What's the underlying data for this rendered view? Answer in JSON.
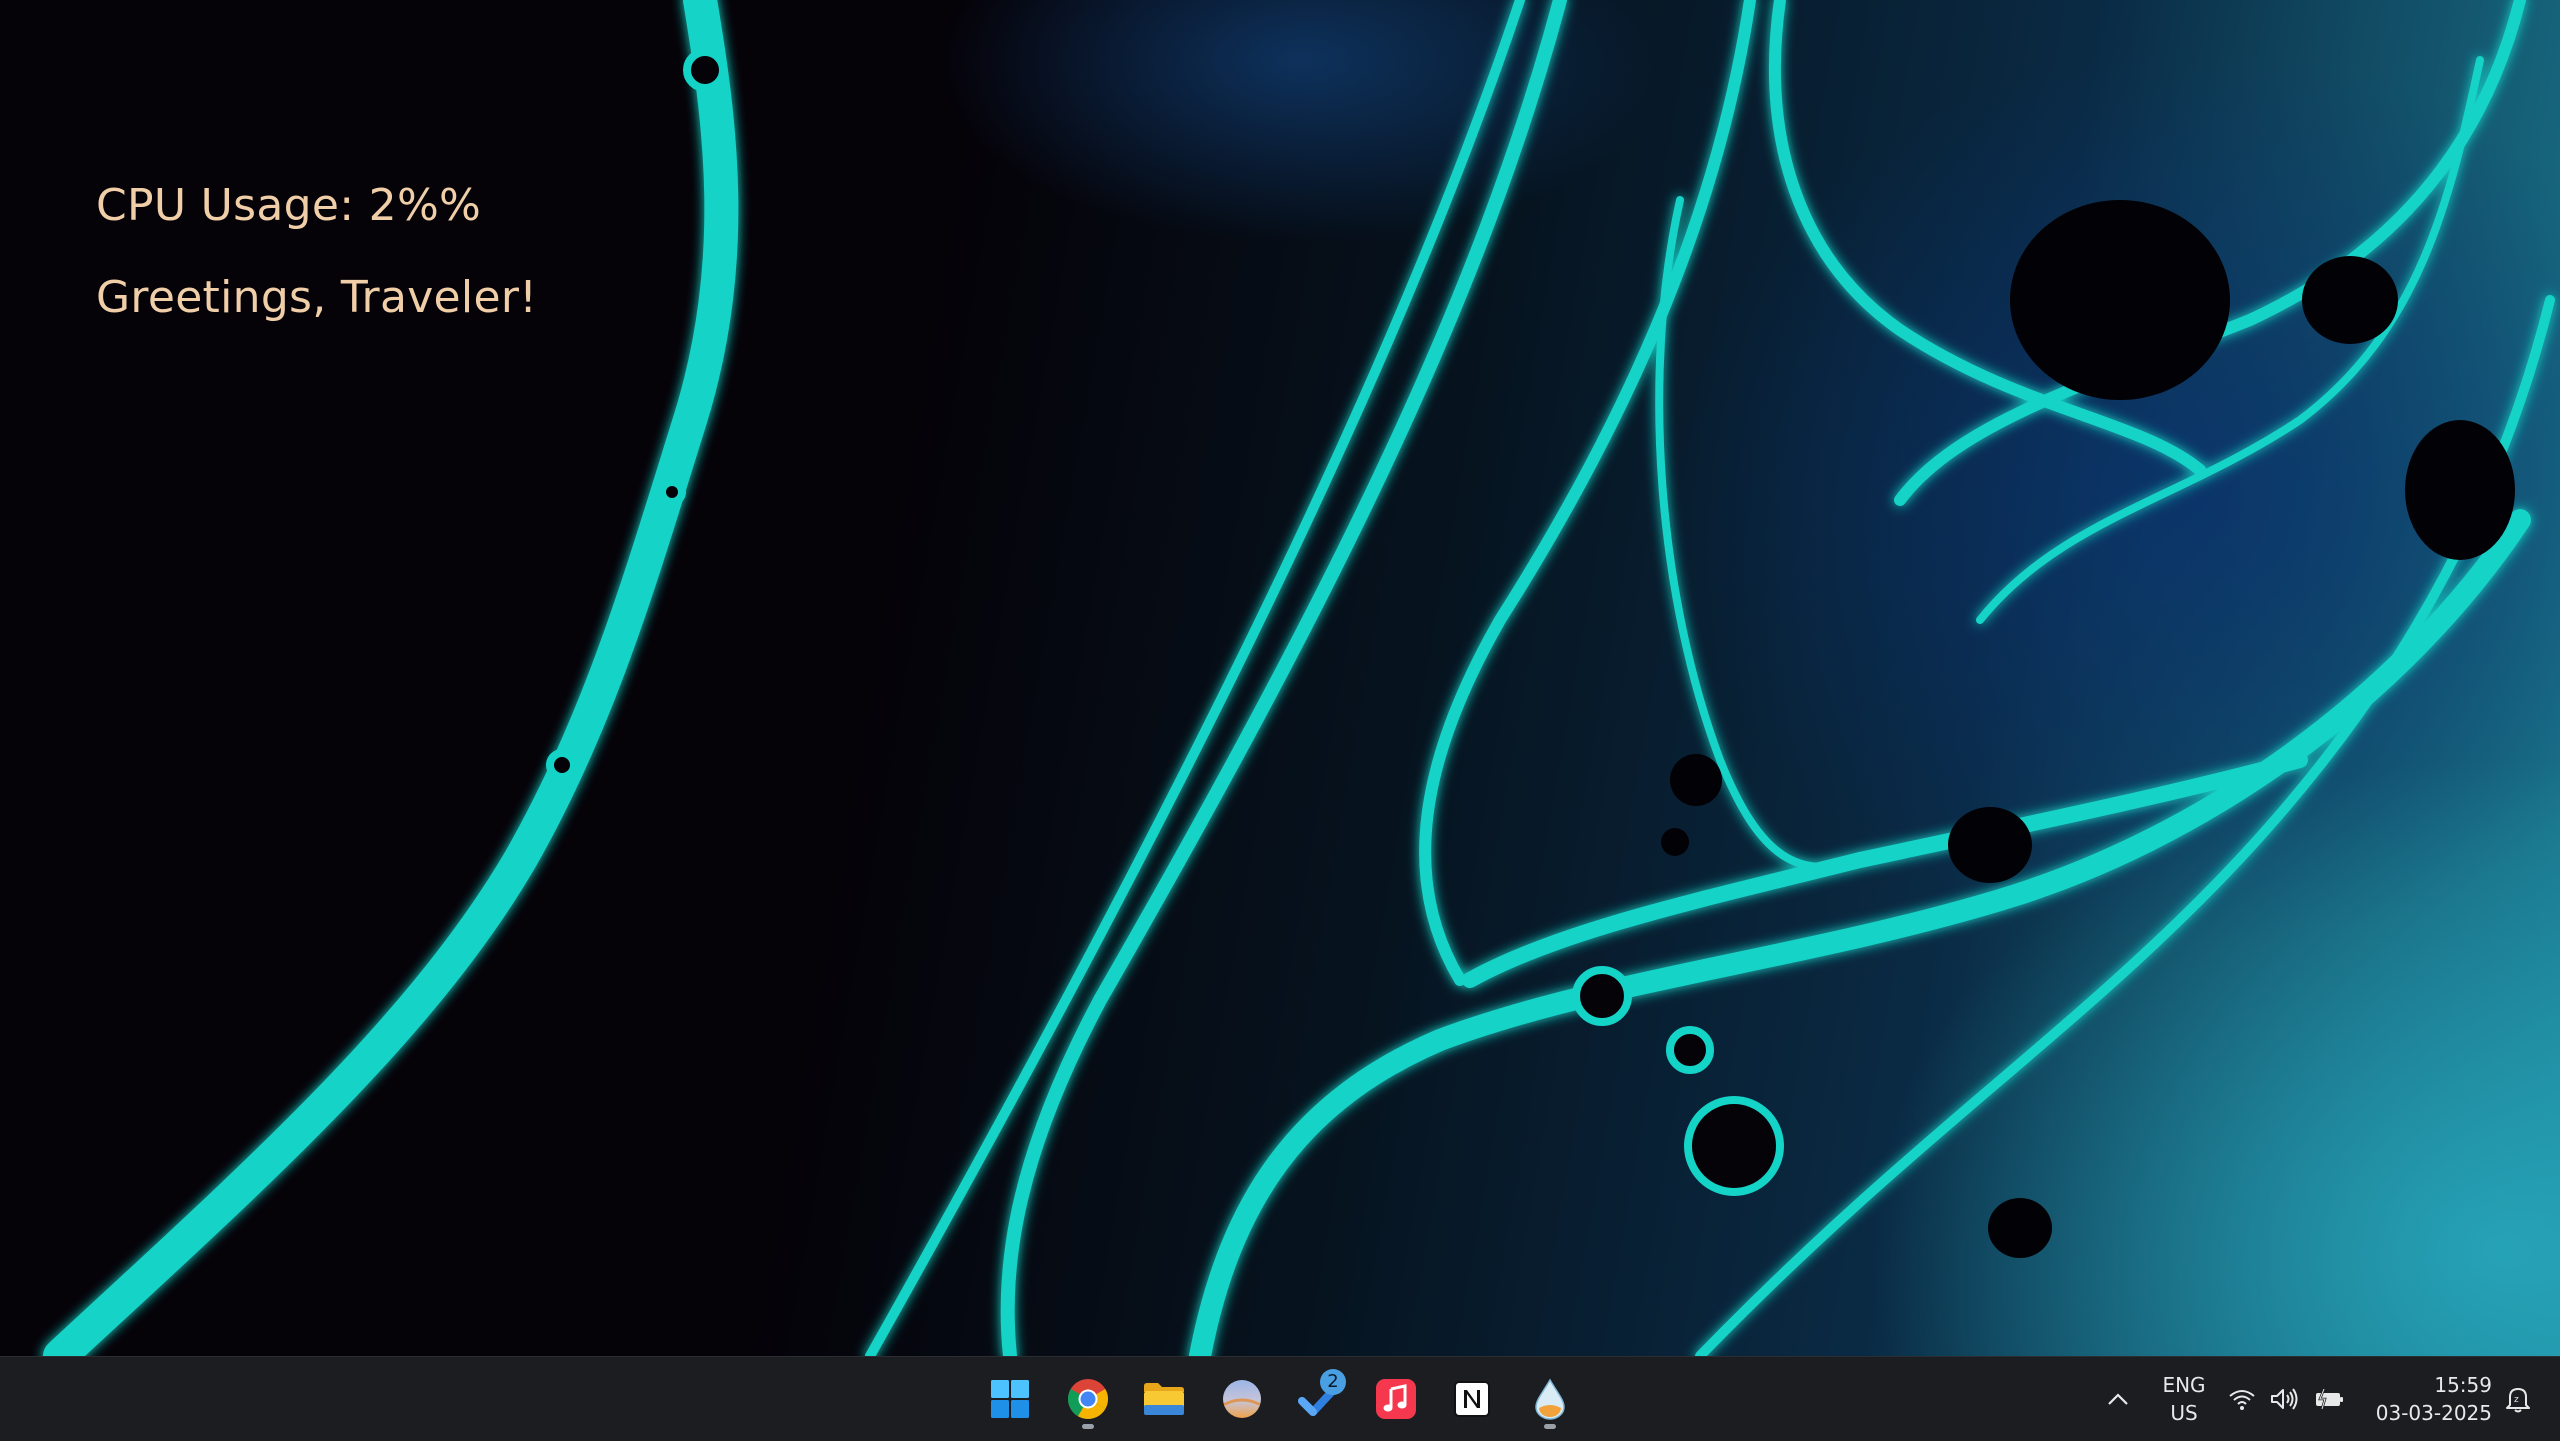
{
  "desktop": {
    "widgets": {
      "cpu_usage": "CPU Usage: 2%%",
      "greeting": "Greetings, Traveler!"
    }
  },
  "taskbar": {
    "apps": [
      {
        "name": "start",
        "icon": "windows-logo-icon",
        "running": false
      },
      {
        "name": "chrome",
        "icon": "chrome-icon",
        "running": true
      },
      {
        "name": "file-explorer",
        "icon": "folder-icon",
        "running": false
      },
      {
        "name": "weather-app",
        "icon": "weather-sphere-icon",
        "running": false
      },
      {
        "name": "tasks",
        "icon": "checkmark-icon",
        "running": false,
        "badge": "2"
      },
      {
        "name": "apple-music",
        "icon": "music-note-icon",
        "running": false
      },
      {
        "name": "notion",
        "icon": "notion-icon",
        "running": false
      },
      {
        "name": "rainmeter",
        "icon": "droplet-icon",
        "running": true
      }
    ],
    "tray": {
      "language_line1": "ENG",
      "language_line2": "US",
      "time": "15:59",
      "date": "03-03-2025"
    }
  },
  "colors": {
    "widget_text": "#f0cfa8",
    "taskbar_bg": "#1b1d21",
    "wallpaper_accent": "#14d3c7"
  }
}
